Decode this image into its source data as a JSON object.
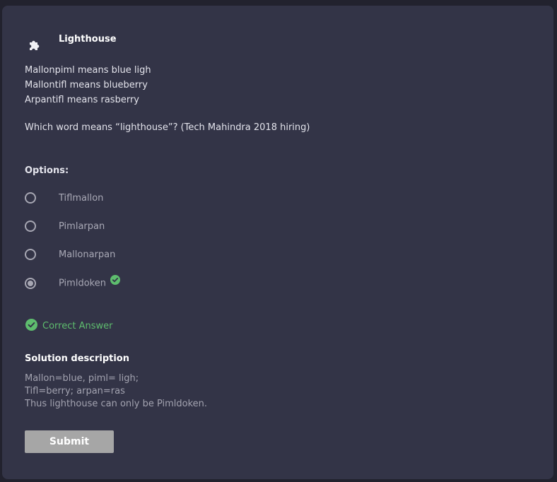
{
  "question": {
    "title": "Lighthouse",
    "lines": [
      "Mallonpiml means blue ligh",
      "Mallontifl means blueberry",
      "Arpantifl means rasberry"
    ],
    "prompt": "Which word means “lighthouse”? (Tech Mahindra 2018 hiring)"
  },
  "options": {
    "label": "Options:",
    "items": [
      {
        "label": "Tiflmallon",
        "selected": false
      },
      {
        "label": "Pimlarpan",
        "selected": false
      },
      {
        "label": "Mallonarpan",
        "selected": false
      },
      {
        "label": "Pimldoken",
        "selected": true
      }
    ]
  },
  "result": {
    "text": "Correct Answer",
    "color": "#5ebd6e"
  },
  "solution": {
    "title": "Solution description",
    "lines": [
      "Mallon=blue, piml= ligh;",
      "Tifl=berry; arpan=ras",
      "Thus lighthouse can only be Pimldoken."
    ]
  },
  "submit_label": "Submit",
  "icons": {
    "header": "puzzle-icon",
    "correct": "check-circle-icon"
  }
}
